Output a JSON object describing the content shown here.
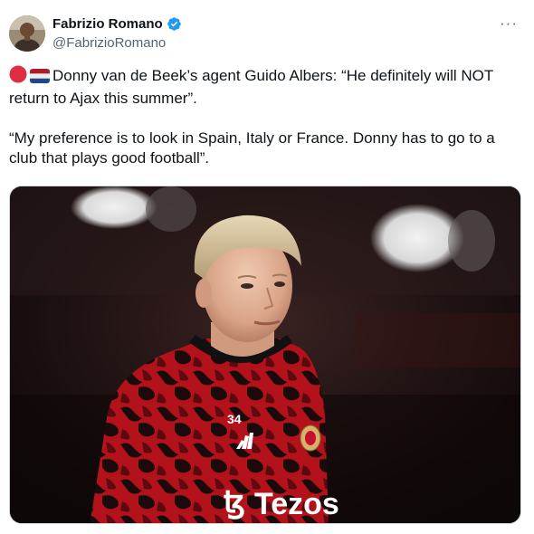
{
  "author": {
    "display_name": "Fabrizio Romano",
    "handle": "@FabrizioRomano",
    "verified": true,
    "avatar_icon": "avatar-photo"
  },
  "menu": {
    "more_label": "···",
    "icon": "more-horizontal-icon"
  },
  "tweet": {
    "flags": [
      "red-circle-emoji",
      "netherlands-flag-emoji"
    ],
    "line1": "Donny van de Beek’s agent Guido Albers: “He definitely will NOT return to Ajax this summer”.",
    "line2": "“My preference is to look in Spain, Italy or France. Donny has to go to a club that plays good football”."
  },
  "media": {
    "type": "photo",
    "shirt_number": "34",
    "sponsor_text": "Tezos",
    "sponsor_logo_text": "ꜩ"
  },
  "colors": {
    "verified_blue": "#1d9bf0",
    "text_primary": "#0f1419",
    "text_secondary": "#536471",
    "border": "#cfd9de",
    "shirt_red": "#b3121b",
    "shirt_dark": "#1a0a0b"
  }
}
